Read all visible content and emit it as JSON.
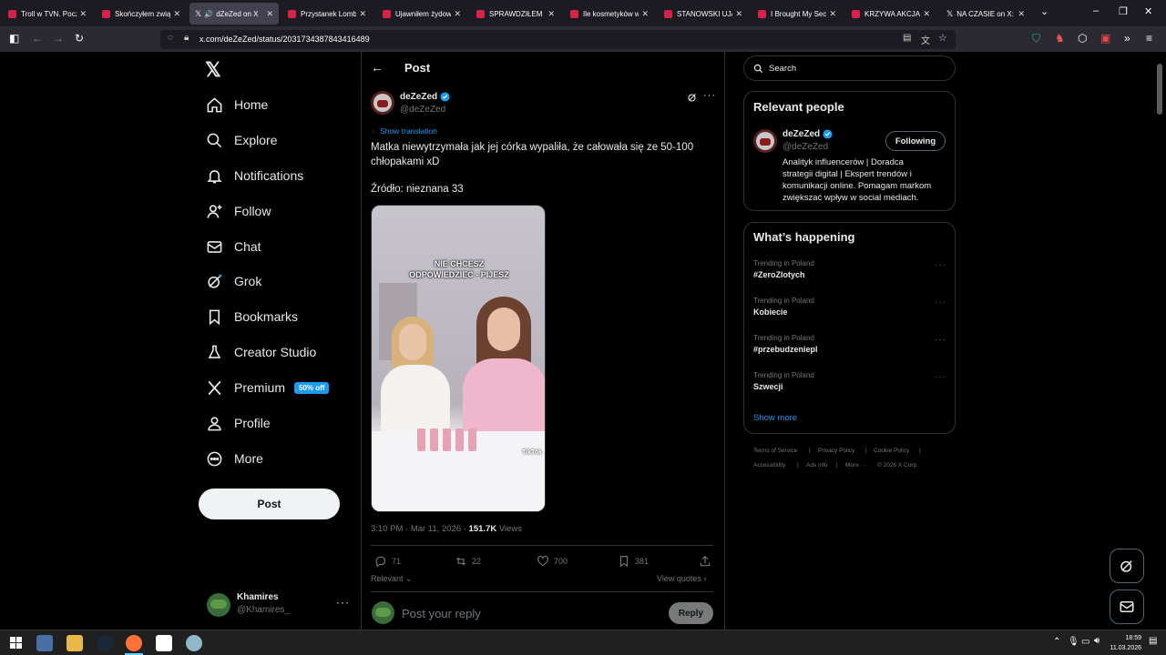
{
  "browser": {
    "tabs": [
      {
        "title": "Troll w TVN. Poczu",
        "color": "#d6224a"
      },
      {
        "title": "Skończyłem związ",
        "color": "#d6224a"
      },
      {
        "title": "dZeZed on X",
        "color": "#ffffff",
        "active": true
      },
      {
        "title": "Przystanek Lomba",
        "color": "#d6224a"
      },
      {
        "title": "Ujawniłem żydows",
        "color": "#d6224a"
      },
      {
        "title": "SPRAWDZIŁEM CZ",
        "color": "#d6224a"
      },
      {
        "title": "Ile kosmetyków w",
        "color": "#d6224a"
      },
      {
        "title": "STANOWSKI UJAW",
        "color": "#d6224a"
      },
      {
        "title": "I Brought My Secr",
        "color": "#d6224a"
      },
      {
        "title": "KRZYWA AKCJA #",
        "color": "#d6224a"
      },
      {
        "title": "NA CZASIE on X: '",
        "color": "#ffffff"
      }
    ],
    "url": "x.com/deZeZed/status/2031734387843416489"
  },
  "sidebar": {
    "items": [
      {
        "label": "Home",
        "icon": "home-icon"
      },
      {
        "label": "Explore",
        "icon": "search-icon"
      },
      {
        "label": "Notifications",
        "icon": "bell-icon"
      },
      {
        "label": "Follow",
        "icon": "person-add-icon"
      },
      {
        "label": "Chat",
        "icon": "mail-icon"
      },
      {
        "label": "Grok",
        "icon": "grok-icon"
      },
      {
        "label": "Bookmarks",
        "icon": "bookmark-icon"
      },
      {
        "label": "Creator Studio",
        "icon": "flask-icon"
      },
      {
        "label": "Premium",
        "icon": "x-logo-icon"
      },
      {
        "label": "Profile",
        "icon": "person-icon"
      },
      {
        "label": "More",
        "icon": "more-circle-icon"
      }
    ],
    "premium_badge": "50% off",
    "post_button": "Post",
    "account": {
      "name": "Khamires",
      "handle": "@Khamires_"
    }
  },
  "post": {
    "header": "Post",
    "author_name": "deZeZed",
    "author_handle": "@deZeZed",
    "show_translation": "Show translation",
    "text_line1": "Matka niewytrzymała jak jej córka wypaliła, że całowała się ze 50-100",
    "text_line2": "chłopakami xD",
    "source": "Źródło: nieznana 33",
    "video_caption_1": "NIE CHCESZ",
    "video_caption_2": "ODPOWIEDZIEĆ - PIJESZ",
    "video_watermark": "TikTok",
    "timestamp": "3:10 PM · Mar 11, 2026 · ",
    "views_count": "151.7K",
    "views_label": " Views",
    "replies": "71",
    "reposts": "22",
    "likes": "700",
    "bookmarks": "381",
    "relevant": "Relevant",
    "view_quotes": "View quotes",
    "reply_placeholder": "Post your reply",
    "reply_button": "Reply"
  },
  "right": {
    "search_placeholder": "Search",
    "relevant_people_title": "Relevant people",
    "person_name": "deZeZed",
    "person_handle": "@deZeZed",
    "following": "Following",
    "bio_1": "Analityk influencerów | Doradca",
    "bio_2": "strategii digital | Ekspert trendów i",
    "bio_3": "komunikacji online. Pomagam markom",
    "bio_4": "zwiększać wpływ w social mediach.",
    "whats_happening": "What’s happening",
    "trends": [
      {
        "context": "Trending in Poland",
        "tag": "#ZeroZlotych"
      },
      {
        "context": "Trending in Poland",
        "tag": "Kobiecie"
      },
      {
        "context": "Trending in Poland",
        "tag": "#przebudzeniepl"
      },
      {
        "context": "Trending in Poland",
        "tag": "Szwecji"
      }
    ],
    "show_more": "Show more",
    "footer": [
      "Terms of Service",
      "Privacy Policy",
      "Cookie Policy",
      "Accessibility",
      "Ads info",
      "More ···",
      "© 2026 X Corp."
    ]
  },
  "taskbar": {
    "time": "18:59",
    "date": "11.03.2026"
  },
  "colors": {
    "accent": "#1d9bf0",
    "background": "#000000",
    "border": "#2f3336"
  }
}
